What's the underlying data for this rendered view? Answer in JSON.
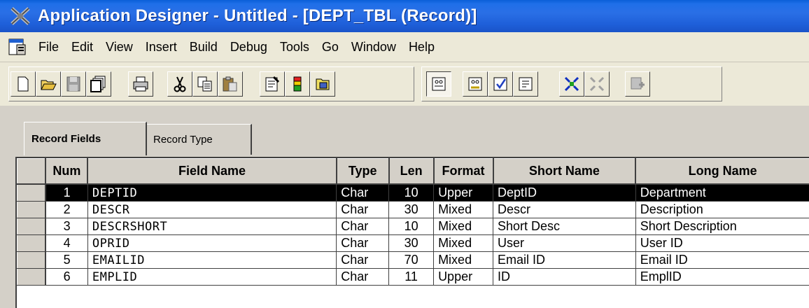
{
  "window": {
    "title": "Application Designer - Untitled - [DEPT_TBL (Record)]"
  },
  "menu": [
    "File",
    "Edit",
    "View",
    "Insert",
    "Build",
    "Debug",
    "Tools",
    "Go",
    "Window",
    "Help"
  ],
  "toolbar": {
    "buttons": [
      "new-icon",
      "open-icon",
      "save-icon",
      "save-all-icon",
      "print-icon",
      "cut-icon",
      "copy-icon",
      "paste-icon",
      "properties-icon",
      "build-icon",
      "project-icon",
      "field-display-icon",
      "use-display-icon",
      "edits-display-icon",
      "peoplecode-display-icon",
      "expand-all-icon",
      "collapse-all-icon",
      "insert-field-icon"
    ]
  },
  "tabs": {
    "record_fields": "Record Fields",
    "record_type": "Record Type"
  },
  "table": {
    "columns": [
      "Num",
      "Field Name",
      "Type",
      "Len",
      "Format",
      "Short Name",
      "Long Name"
    ],
    "rows": [
      {
        "num": "1",
        "field": "DEPTID",
        "type": "Char",
        "len": "10",
        "format": "Upper",
        "short": "DeptID",
        "long": "Department"
      },
      {
        "num": "2",
        "field": "DESCR",
        "type": "Char",
        "len": "30",
        "format": "Mixed",
        "short": "Descr",
        "long": "Description"
      },
      {
        "num": "3",
        "field": "DESCRSHORT",
        "type": "Char",
        "len": "10",
        "format": "Mixed",
        "short": "Short Desc",
        "long": "Short Description"
      },
      {
        "num": "4",
        "field": "OPRID",
        "type": "Char",
        "len": "30",
        "format": "Mixed",
        "short": "User",
        "long": "User ID"
      },
      {
        "num": "5",
        "field": "EMAILID",
        "type": "Char",
        "len": "70",
        "format": "Mixed",
        "short": "Email ID",
        "long": "Email ID"
      },
      {
        "num": "6",
        "field": "EMPLID",
        "type": "Char",
        "len": "11",
        "format": "Upper",
        "short": "ID",
        "long": "EmplID"
      }
    ],
    "selected_row": 0
  }
}
